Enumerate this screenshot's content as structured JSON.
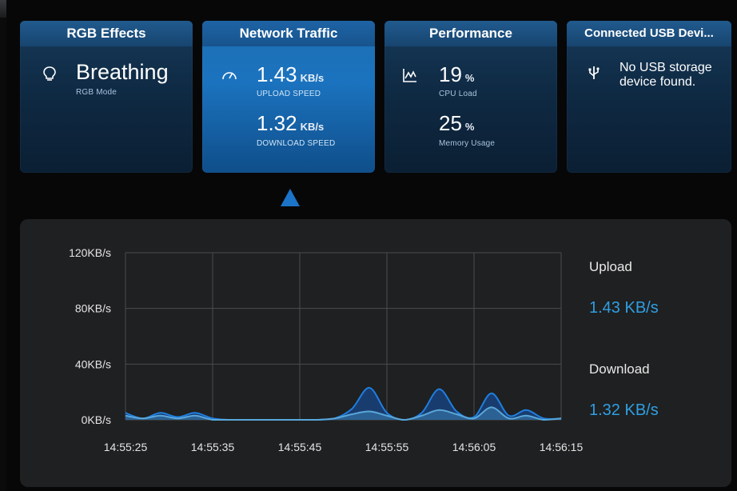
{
  "cards": [
    {
      "title": "RGB Effects",
      "value": "Breathing",
      "caption": "RGB Mode",
      "icon": "lightbulb-icon"
    },
    {
      "title": "Network Traffic",
      "upload": {
        "value": "1.43",
        "unit": "KB/s",
        "caption": "UPLOAD SPEED"
      },
      "download": {
        "value": "1.32",
        "unit": "KB/s",
        "caption": "DOWNLOAD SPEED"
      },
      "icon": "speedometer-icon"
    },
    {
      "title": "Performance",
      "cpu": {
        "value": "19",
        "unit": "%",
        "caption": "CPU Load"
      },
      "memory": {
        "value": "25",
        "unit": "%",
        "caption": "Memory Usage"
      },
      "icon": "chart-line-icon"
    },
    {
      "title": "Connected USB Devi...",
      "message": "No USB storage device found.",
      "icon": "usb-icon"
    }
  ],
  "legend": {
    "upload_label": "Upload",
    "upload_value": "1.43 KB/s",
    "download_label": "Download",
    "download_value": "1.32 KB/s"
  },
  "colors": {
    "upload": "#1f7fe0",
    "download": "#5aa7d9",
    "accent": "#2e9fe3"
  },
  "chart_data": {
    "type": "area",
    "x": [
      "14:55:25",
      "14:55:27",
      "14:55:29",
      "14:55:31",
      "14:55:33",
      "14:55:35",
      "14:55:37",
      "14:55:39",
      "14:55:41",
      "14:55:43",
      "14:55:45",
      "14:55:47",
      "14:55:49",
      "14:55:51",
      "14:55:53",
      "14:55:55",
      "14:55:57",
      "14:55:59",
      "14:56:01",
      "14:56:03",
      "14:56:05",
      "14:56:07",
      "14:56:09",
      "14:56:11",
      "14:56:13",
      "14:56:15"
    ],
    "xticks": [
      "14:55:25",
      "14:55:35",
      "14:55:45",
      "14:55:55",
      "14:56:05",
      "14:56:15"
    ],
    "yticks": [
      "0KB/s",
      "40KB/s",
      "80KB/s",
      "120KB/s"
    ],
    "ylim": [
      0,
      120
    ],
    "grid": true,
    "series": [
      {
        "name": "Upload",
        "values": [
          5,
          1,
          5,
          2,
          5,
          1,
          0,
          0,
          0,
          0,
          0,
          0,
          1,
          8,
          23,
          5,
          0,
          5,
          22,
          6,
          2,
          19,
          3,
          7,
          1,
          1
        ]
      },
      {
        "name": "Download",
        "values": [
          3,
          1,
          3,
          1,
          3,
          0,
          0,
          0,
          0,
          0,
          0,
          0,
          1,
          4,
          6,
          3,
          0,
          3,
          7,
          4,
          1,
          9,
          1,
          3,
          0,
          1
        ]
      }
    ]
  }
}
